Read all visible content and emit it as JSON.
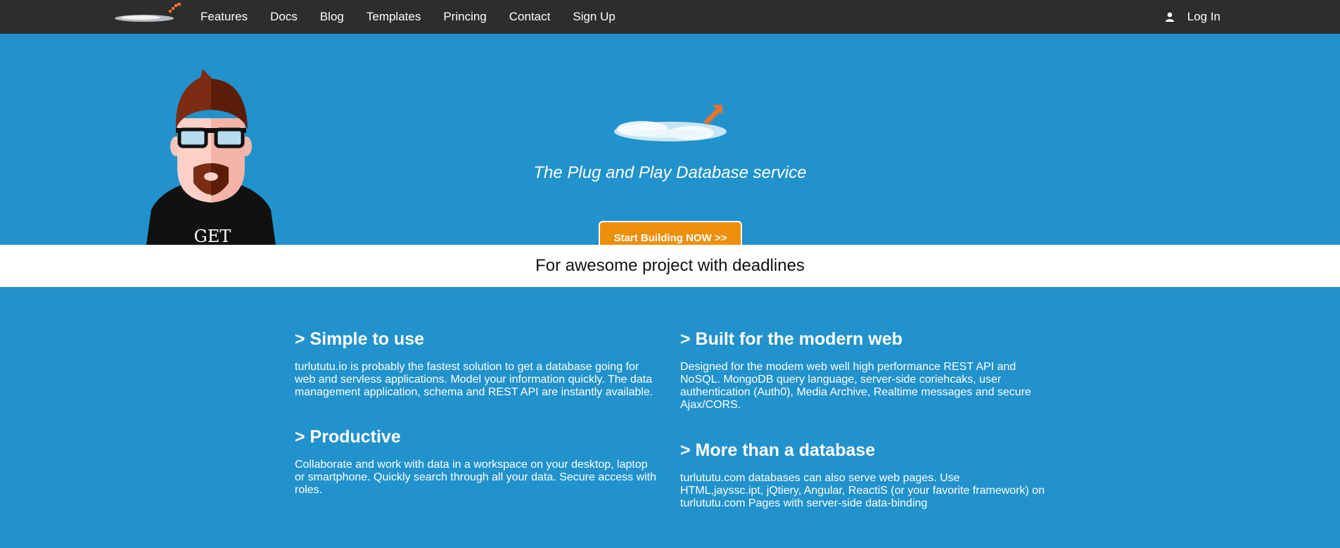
{
  "nav": {
    "links": [
      "Features",
      "Docs",
      "Blog",
      "Templates",
      "Princing",
      "Contact",
      "Sign Up"
    ],
    "login_label": "Log In",
    "icons": {
      "logo": "brand-logo",
      "user": "user-icon"
    }
  },
  "hero": {
    "tagline": "The Plug and Play Database service",
    "cta_label": "Start Building NOW >>",
    "avatar_shirt_text": "GET"
  },
  "band": {
    "text": "For awesome project with deadlines"
  },
  "features": [
    {
      "title": "> Simple to use",
      "body": "turlututu.io is probably the fastest solution to get a database going for web and servless applications. Model your information quickly. The data management application, schema and REST API are instantly available."
    },
    {
      "title": "> Built for the modern web",
      "body": "Designed for the modem web well high performance REST API and NoSQL. MongoDB query language, server-side coriehcaks, user authentication (Auth0), Media Archive, Realtime messages and secure Ajax/CORS."
    },
    {
      "title": "> Productive",
      "body": "Collaborate and work with data in a workspace on your desktop, laptop or smartphone. Quickly search through all your data. Secure access with roles."
    },
    {
      "title": "> More than a database",
      "body": "turlututu.com databases can also serve web pages. Use HTML,jayssc.ipt, jQtiery, Angular, ReactiS (or your favorite framework) on turlututu.com Pages with server-side data-binding"
    }
  ],
  "colors": {
    "nav_bg": "#2d2d2d",
    "hero_bg": "#2192cc",
    "accent": "#ee8f0a"
  }
}
